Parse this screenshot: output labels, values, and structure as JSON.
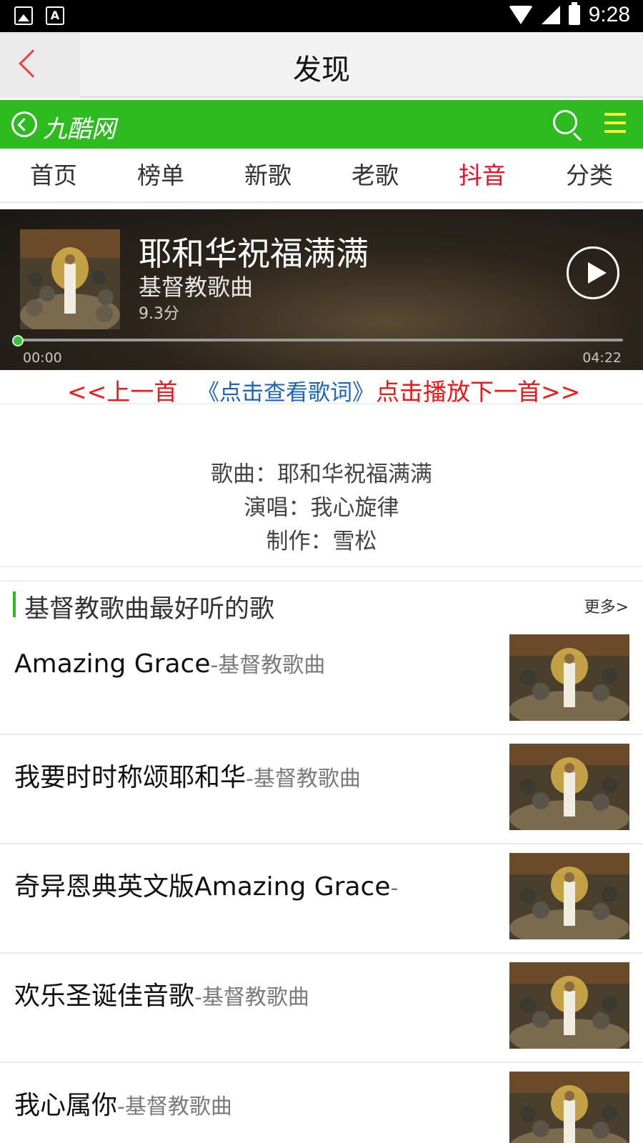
{
  "status": {
    "time": "9:28"
  },
  "header": {
    "title": "发现"
  },
  "site": {
    "name": "九酷网"
  },
  "nav": {
    "tabs": [
      {
        "label": "首页"
      },
      {
        "label": "榜单"
      },
      {
        "label": "新歌"
      },
      {
        "label": "老歌"
      },
      {
        "label": "抖音",
        "active": true
      },
      {
        "label": "分类"
      }
    ]
  },
  "player": {
    "title": "耶和华祝福满满",
    "artist": "基督教歌曲",
    "score": "9.3分",
    "current_time": "00:00",
    "total_time": "04:22",
    "progress": 0
  },
  "controls": {
    "prev": "<<上一首",
    "lyrics": "《点击查看歌词》",
    "next": "点击播放下一首>>"
  },
  "info": {
    "song_line": "歌曲：耶和华祝福满满",
    "singer_line": "演唱：我心旋律",
    "producer_line": "制作：雪松"
  },
  "section": {
    "title": "基督教歌曲最好听的歌",
    "more": "更多>"
  },
  "songs": [
    {
      "title": "Amazing Grace",
      "sub": "-基督教歌曲"
    },
    {
      "title": "我要时时称颂耶和华",
      "sub": "-基督教歌曲"
    },
    {
      "title": "奇异恩典英文版Amazing Grace",
      "sub": "-"
    },
    {
      "title": "欢乐圣诞佳音歌",
      "sub": "-基督教歌曲"
    },
    {
      "title": "我心属你",
      "sub": "-基督教歌曲"
    }
  ],
  "colors": {
    "site_green": "#2dbb1f",
    "active_tab": "#e8102c",
    "control_red": "#f01818",
    "lyrics_blue": "#1d64b8"
  }
}
